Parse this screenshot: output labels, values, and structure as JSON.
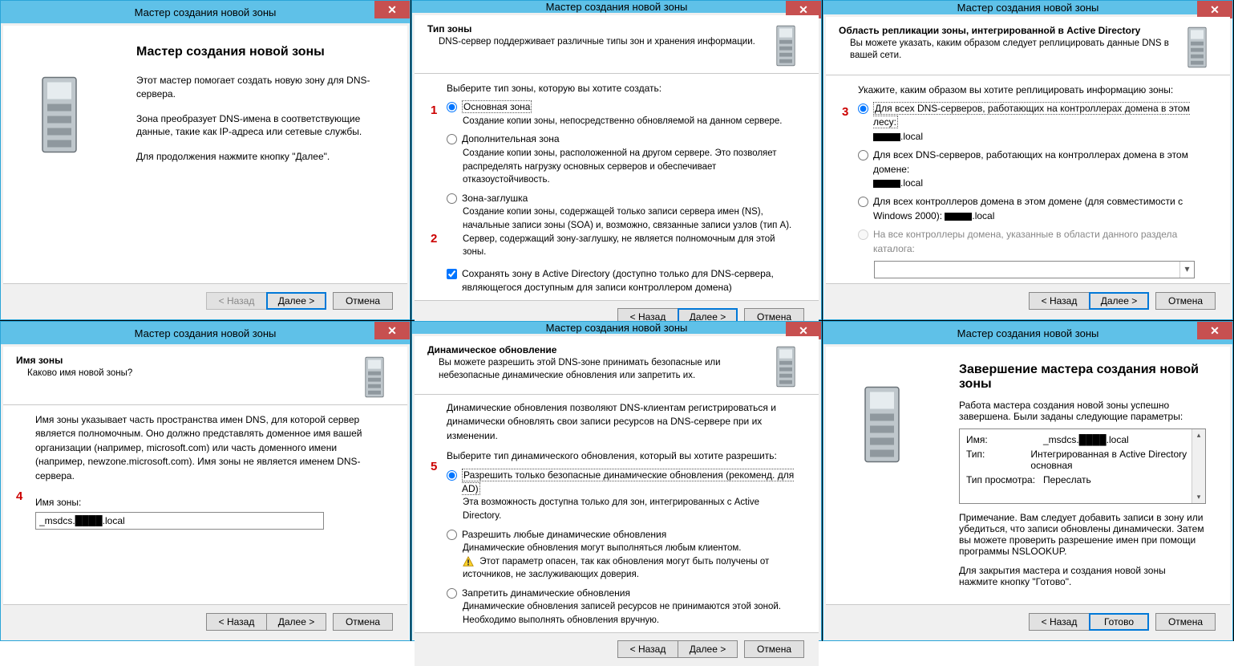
{
  "common": {
    "title": "Мастер создания новой зоны",
    "back": "< Назад",
    "next": "Далее >",
    "cancel": "Отмена",
    "finish": "Готово"
  },
  "annot": {
    "n1": "1",
    "n2": "2",
    "n3": "3",
    "n4": "4",
    "n5": "5"
  },
  "p1": {
    "wtitle": "Мастер создания новой зоны",
    "l1": "Этот мастер помогает создать новую зону для DNS-сервера.",
    "l2": "Зона преобразует DNS-имена в соответствующие данные, такие как IP-адреса или сетевые службы.",
    "l3": "Для продолжения нажмите кнопку \"Далее\"."
  },
  "p2": {
    "h": "Тип зоны",
    "sub": "DNS-сервер поддерживает различные типы зон и хранения информации.",
    "lead": "Выберите тип зоны, которую вы хотите создать:",
    "r1": "Основная зона",
    "r1d": "Создание копии зоны, непосредственно обновляемой на данном сервере.",
    "r2": "Дополнительная зона",
    "r2d": "Создание копии зоны, расположенной на другом сервере. Это позволяет распределять нагрузку основных серверов и обеспечивает отказоустойчивость.",
    "r3": "Зона-заглушка",
    "r3d": "Создание копии зоны, содержащей только записи сервера имен (NS), начальные записи зоны (SOA) и, возможно, связанные записи узлов (тип A). Сервер, содержащий зону-заглушку, не является полномочным для этой зоны.",
    "chk": "Сохранять зону в Active Directory (доступно только для DNS-сервера, являющегося доступным для записи контроллером домена)"
  },
  "p3": {
    "h": "Область репликации зоны, интегрированной в Active Directory",
    "sub": "Вы можете указать, каким образом следует реплицировать данные DNS в вашей сети.",
    "lead": "Укажите, каким образом вы хотите реплицировать информацию зоны:",
    "r1a": "Для всех DNS-серверов, работающих на контроллерах домена в этом лесу:",
    "r1b": ".local",
    "r2a": "Для всех DNS-серверов, работающих на контроллерах домена в этом домене:",
    "r2b": ".local",
    "r3a": "Для всех контроллеров домена в этом домене (для совместимости с Windows 2000): ",
    "r3b": ".local",
    "r4": "На все контроллеры домена, указанные в области данного раздела каталога:"
  },
  "p4": {
    "h": "Имя зоны",
    "sub": "Каково имя новой зоны?",
    "desc": "Имя зоны указывает часть пространства имен DNS, для которой сервер является полномочным. Оно должно представлять доменное имя вашей организации (например, microsoft.com) или часть доменного имени (например, newzone.microsoft.com). Имя зоны не является именем DNS-сервера.",
    "lbl": "Имя зоны:",
    "val": "_msdcs.████.local"
  },
  "p5": {
    "h": "Динамическое обновление",
    "sub": "Вы можете разрешить этой DNS-зоне принимать безопасные или небезопасные динамические обновления или запретить их.",
    "desc": "Динамические обновления позволяют DNS-клиентам регистрироваться и динамически обновлять свои записи ресурсов на DNS-сервере при их изменении.",
    "lead": "Выберите тип динамического обновления, который вы хотите разрешить:",
    "r1": "Разрешить только безопасные динамические обновления (рекоменд. для AD)",
    "r1d": "Эта возможность доступна только для зон, интегрированных с Active Directory.",
    "r2": "Разрешить любые динамические обновления",
    "r2d": "Динамические обновления могут выполняться любым клиентом.",
    "r2w": "Этот параметр опасен, так как обновления могут быть получены от источников, не заслуживающих доверия.",
    "r3": "Запретить динамические обновления",
    "r3d": "Динамические обновления записей ресурсов не принимаются этой зоной. Необходимо выполнять обновления вручную."
  },
  "p6": {
    "wtitle": "Завершение мастера создания новой зоны",
    "lead": "Работа мастера создания новой зоны успешно завершена. Были заданы следующие параметры:",
    "k_name": "Имя:",
    "v_name": "_msdcs.████.local",
    "k_type": "Тип:",
    "v_type": "Интегрированная в Active Directory основная",
    "k_view": "Тип просмотра:",
    "v_view": "Переслать",
    "note": "Примечание. Вам следует добавить записи в зону или убедиться, что записи обновлены динамически. Затем вы можете проверить разрешение имен при помощи программы NSLOOKUP.",
    "close": "Для закрытия мастера и создания новой зоны нажмите кнопку \"Готово\"."
  }
}
